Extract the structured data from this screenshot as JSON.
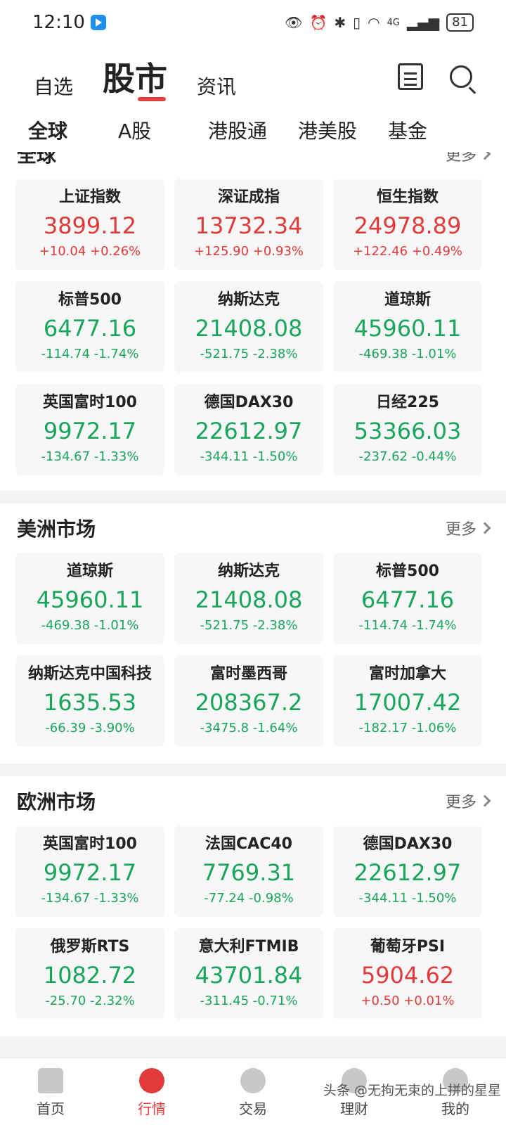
{
  "status_bar": {
    "time": "12:10",
    "battery": "81",
    "network": "4G"
  },
  "top_nav": {
    "tabs": [
      "自选",
      "股市",
      "资讯"
    ]
  },
  "sub_tabs": [
    "全球",
    "A股",
    "港股通",
    "港美股",
    "基金"
  ],
  "colors": {
    "up": "#e03a3a",
    "down": "#19a55c",
    "accent": "#e03a3a"
  },
  "sections": [
    {
      "title": "全球",
      "more": "更多",
      "cards": [
        {
          "name": "上证指数",
          "value": "3899.12",
          "change": "+10.04 +0.26%",
          "dir": "up"
        },
        {
          "name": "深证成指",
          "value": "13732.34",
          "change": "+125.90 +0.93%",
          "dir": "up"
        },
        {
          "name": "恒生指数",
          "value": "24978.89",
          "change": "+122.46 +0.49%",
          "dir": "up"
        },
        {
          "name": "标普500",
          "value": "6477.16",
          "change": "-114.74 -1.74%",
          "dir": "down"
        },
        {
          "name": "纳斯达克",
          "value": "21408.08",
          "change": "-521.75 -2.38%",
          "dir": "down"
        },
        {
          "name": "道琼斯",
          "value": "45960.11",
          "change": "-469.38 -1.01%",
          "dir": "down"
        },
        {
          "name": "英国富时100",
          "value": "9972.17",
          "change": "-134.67 -1.33%",
          "dir": "down"
        },
        {
          "name": "德国DAX30",
          "value": "22612.97",
          "change": "-344.11 -1.50%",
          "dir": "down"
        },
        {
          "name": "日经225",
          "value": "53366.03",
          "change": "-237.62 -0.44%",
          "dir": "down"
        }
      ]
    },
    {
      "title": "美洲市场",
      "more": "更多",
      "cards": [
        {
          "name": "道琼斯",
          "value": "45960.11",
          "change": "-469.38 -1.01%",
          "dir": "down"
        },
        {
          "name": "纳斯达克",
          "value": "21408.08",
          "change": "-521.75 -2.38%",
          "dir": "down"
        },
        {
          "name": "标普500",
          "value": "6477.16",
          "change": "-114.74 -1.74%",
          "dir": "down"
        },
        {
          "name": "纳斯达克中国科技",
          "value": "1635.53",
          "change": "-66.39 -3.90%",
          "dir": "down"
        },
        {
          "name": "富时墨西哥",
          "value": "208367.2",
          "change": "-3475.8 -1.64%",
          "dir": "down"
        },
        {
          "name": "富时加拿大",
          "value": "17007.42",
          "change": "-182.17 -1.06%",
          "dir": "down"
        }
      ]
    },
    {
      "title": "欧洲市场",
      "more": "更多",
      "cards": [
        {
          "name": "英国富时100",
          "value": "9972.17",
          "change": "-134.67 -1.33%",
          "dir": "down"
        },
        {
          "name": "法国CAC40",
          "value": "7769.31",
          "change": "-77.24 -0.98%",
          "dir": "down"
        },
        {
          "name": "德国DAX30",
          "value": "22612.97",
          "change": "-344.11 -1.50%",
          "dir": "down"
        },
        {
          "name": "俄罗斯RTS",
          "value": "1082.72",
          "change": "-25.70 -2.32%",
          "dir": "down"
        },
        {
          "name": "意大利FTMIB",
          "value": "43701.84",
          "change": "-311.45 -0.71%",
          "dir": "down"
        },
        {
          "name": "葡萄牙PSI",
          "value": "5904.62",
          "change": "+0.50 +0.01%",
          "dir": "up"
        }
      ]
    }
  ],
  "bottom_nav": {
    "items": [
      {
        "label": "首页",
        "icon": "home-icon"
      },
      {
        "label": "行情",
        "icon": "market-icon"
      },
      {
        "label": "交易",
        "icon": "trade-icon"
      },
      {
        "label": "理财",
        "icon": "wealth-icon"
      },
      {
        "label": "我的",
        "icon": "profile-icon"
      }
    ]
  },
  "watermark": "头条 @无拘无束的上拼的星星"
}
